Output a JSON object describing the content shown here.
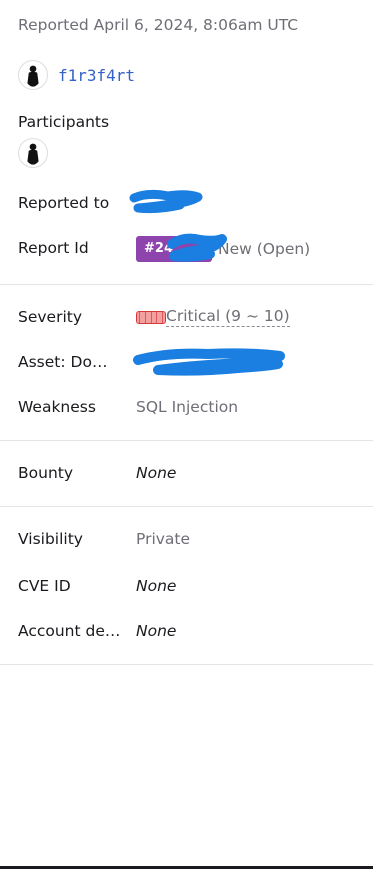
{
  "header": {
    "reported_date": "Reported April 6, 2024, 8:06am UTC"
  },
  "reporter": {
    "username": "f1r3f4rt"
  },
  "participants": {
    "label": "Participants"
  },
  "reported_to": {
    "label": "Reported to",
    "value": ""
  },
  "report_id": {
    "label": "Report Id",
    "number": "#24",
    "state": "New (Open)"
  },
  "severity": {
    "label": "Severity",
    "value": "Critical (9 ~ 10)"
  },
  "asset": {
    "label": "Asset: Domain",
    "value": ""
  },
  "weakness": {
    "label": "Weakness",
    "value": "SQL Injection"
  },
  "bounty": {
    "label": "Bounty",
    "value": "None"
  },
  "visibility": {
    "label": "Visibility",
    "value": "Private"
  },
  "cve_id": {
    "label": "CVE ID",
    "value": "None"
  },
  "account_details": {
    "label": "Account details",
    "value": "None"
  },
  "colors": {
    "link": "#3461c8",
    "badge": "#8e44ad",
    "severity_critical": "#f4a0a0",
    "redaction": "#1a7fe0"
  },
  "icons": {
    "reporter_avatar": "silhouette-avatar-icon",
    "participant_avatar": "silhouette-avatar-icon",
    "severity": "severity-meter-icon"
  }
}
